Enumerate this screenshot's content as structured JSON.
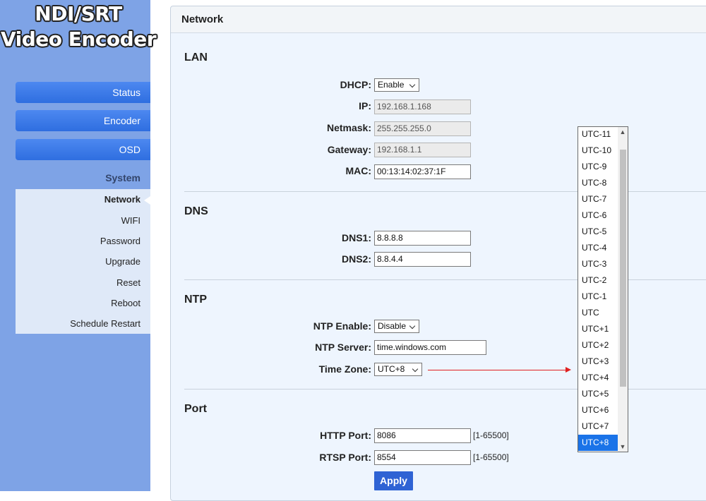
{
  "brand": {
    "line1": "NDI/SRT",
    "line2": "Video Encoder"
  },
  "nav": {
    "status": "Status",
    "encoder": "Encoder",
    "osd": "OSD"
  },
  "system": {
    "heading": "System",
    "items": [
      "Network",
      "WIFI",
      "Password",
      "Upgrade",
      "Reset",
      "Reboot",
      "Schedule Restart"
    ]
  },
  "panel": {
    "title": "Network"
  },
  "lan": {
    "heading": "LAN",
    "dhcp_label": "DHCP:",
    "dhcp_value": "Enable",
    "ip_label": "IP:",
    "ip_value": "192.168.1.168",
    "netmask_label": "Netmask:",
    "netmask_value": "255.255.255.0",
    "gateway_label": "Gateway:",
    "gateway_value": "192.168.1.1",
    "mac_label": "MAC:",
    "mac_value": "00:13:14:02:37:1F"
  },
  "dns": {
    "heading": "DNS",
    "dns1_label": "DNS1:",
    "dns1_value": "8.8.8.8",
    "dns2_label": "DNS2:",
    "dns2_value": "8.8.4.4"
  },
  "ntp": {
    "heading": "NTP",
    "enable_label": "NTP Enable:",
    "enable_value": "Disable",
    "server_label": "NTP Server:",
    "server_value": "time.windows.com",
    "timezone_label": "Time Zone:",
    "timezone_value": "UTC+8"
  },
  "port": {
    "heading": "Port",
    "http_label": "HTTP Port:",
    "http_value": "8086",
    "http_range": "[1-65500]",
    "rtsp_label": "RTSP Port:",
    "rtsp_value": "8554",
    "rtsp_range": "[1-65500]"
  },
  "apply_label": "Apply",
  "timezone_options": [
    "UTC-11",
    "UTC-10",
    "UTC-9",
    "UTC-8",
    "UTC-7",
    "UTC-6",
    "UTC-5",
    "UTC-4",
    "UTC-3",
    "UTC-2",
    "UTC-1",
    "UTC",
    "UTC+1",
    "UTC+2",
    "UTC+3",
    "UTC+4",
    "UTC+5",
    "UTC+6",
    "UTC+7",
    "UTC+8"
  ],
  "timezone_selected": "UTC+8",
  "colors": {
    "sidebar": "#7ea3e6",
    "nav_button": "#3a7ae8",
    "panel_bg": "#eef5fe",
    "apply_button": "#2f63d4",
    "arrow": "#e02020",
    "selected_option": "#1a73e8"
  },
  "icons": {
    "scroll_up": "chevron-up-icon",
    "scroll_down": "chevron-down-icon",
    "select_caret": "chevron-down-icon"
  }
}
